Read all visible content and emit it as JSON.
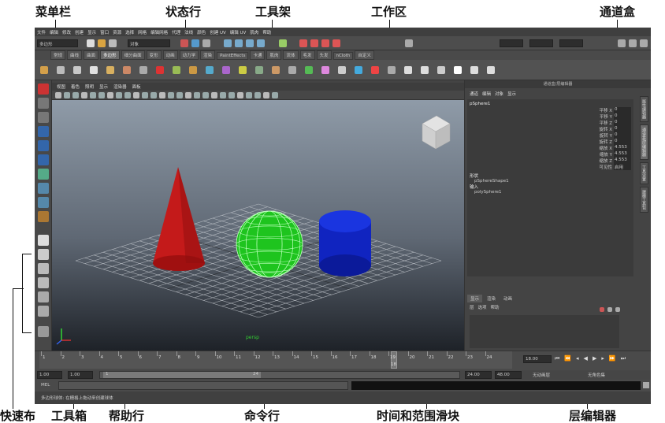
{
  "annotations": {
    "menubar": "菜单栏",
    "statusline": "状态行",
    "shelf": "工具架",
    "workspace": "工作区",
    "channelbox": "通道盒",
    "quicklayout": "快速布",
    "toolbox": "工具箱",
    "helpline": "帮助行",
    "commandline": "命令行",
    "timeslider": "时间和范围滑块",
    "layereditor": "层编辑器"
  },
  "menus": [
    "文件",
    "编辑",
    "修改",
    "创建",
    "显示",
    "窗口",
    "资源",
    "选择",
    "网格",
    "编辑网格",
    "代理",
    "法线",
    "颜色",
    "创建 UV",
    "编辑 UV",
    "肌肉",
    "帮助"
  ],
  "status": {
    "mode": "多边形",
    "object": "对象"
  },
  "shelf_tabs": [
    "常规",
    "曲线",
    "曲面",
    "多边形",
    "细分曲面",
    "变形",
    "动画",
    "动力学",
    "渲染",
    "PaintEffects",
    "卡通",
    "肌肉",
    "流体",
    "毛发",
    "头发",
    "nCloth",
    "自定义"
  ],
  "shelf_active": "多边形",
  "viewport_menu": [
    "视图",
    "着色",
    "照明",
    "显示",
    "渲染器",
    "面板"
  ],
  "viewport_label": "persp",
  "channel": {
    "title": "通道盒/层编辑器",
    "menu": [
      "通道",
      "编辑",
      "对象",
      "显示"
    ],
    "object": "pSphere1",
    "attrs": [
      {
        "name": "平移 X",
        "value": "0"
      },
      {
        "name": "平移 Y",
        "value": "0"
      },
      {
        "name": "平移 Z",
        "value": "0"
      },
      {
        "name": "旋转 X",
        "value": "0"
      },
      {
        "name": "旋转 Y",
        "value": "0"
      },
      {
        "name": "旋转 Z",
        "value": "0"
      },
      {
        "name": "缩放 X",
        "value": "4.553"
      },
      {
        "name": "缩放 Y",
        "value": "4.553"
      },
      {
        "name": "缩放 Z",
        "value": "4.553"
      },
      {
        "name": "可见性",
        "value": "启用"
      }
    ],
    "shapes_label": "形状",
    "shape": "pSphereShape1",
    "inputs_label": "输入",
    "input": "polySphere1"
  },
  "side_tabs": [
    "属性编辑器",
    "通道盒/层编辑器",
    "工具设置",
    "建模工具包"
  ],
  "layer": {
    "tabs": [
      "显示",
      "渲染",
      "动画"
    ],
    "menu": [
      "层",
      "选项",
      "帮助"
    ]
  },
  "timeline": {
    "ticks": [
      "1",
      "2",
      "3",
      "4",
      "5",
      "6",
      "7",
      "8",
      "9",
      "10",
      "11",
      "12",
      "13",
      "14",
      "15",
      "16",
      "17",
      "18",
      "19",
      "20",
      "21",
      "22",
      "23",
      "24"
    ],
    "current_frame": "18",
    "current_field": "18.00"
  },
  "range": {
    "start": "1.00",
    "start2": "1.00",
    "slider_start": "1",
    "slider_end": "24",
    "end": "24.00",
    "end2": "48.00",
    "anim_layer": "无动画层",
    "char_set": "无角色集"
  },
  "command": {
    "label": "MEL"
  },
  "help_text": "多边形球体: 在栅格上拖动来创建球体"
}
